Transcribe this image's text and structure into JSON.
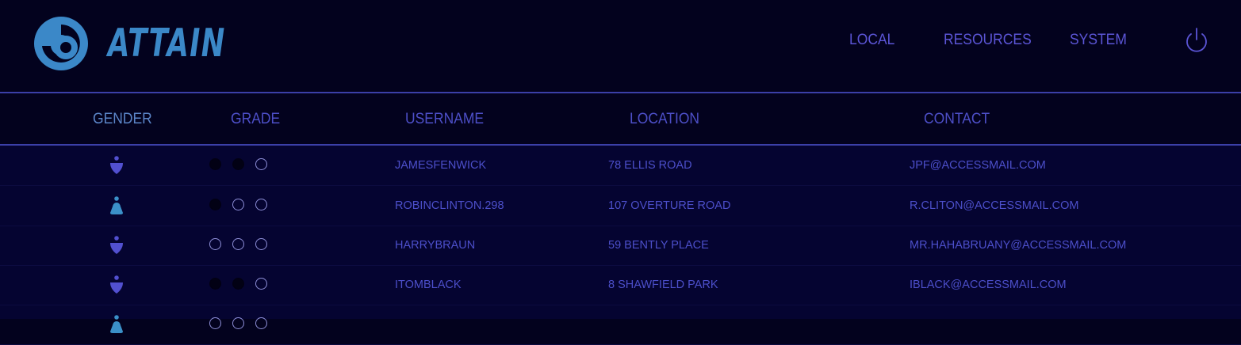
{
  "brand": {
    "name": "ATTAIN",
    "color": "#3b88c8"
  },
  "nav": {
    "items": [
      {
        "label": "LOCAL"
      },
      {
        "label": "RESOURCES"
      },
      {
        "label": "SYSTEM"
      }
    ],
    "power_icon": "power-icon"
  },
  "columns": {
    "gender": "GENDER",
    "grade": "GRADE",
    "username": "USERNAME",
    "location": "LOCATION",
    "contact": "CONTACT"
  },
  "rows": [
    {
      "gender": "male",
      "grade": 2,
      "username": "JAMESFENWICK",
      "location": "78 ELLIS ROAD",
      "contact": "JPF@ACCESSMAIL.COM"
    },
    {
      "gender": "female",
      "grade": 1,
      "username": "ROBINCLINTON.298",
      "location": "107 OVERTURE ROAD",
      "contact": "R.CLITON@ACCESSMAIL.COM"
    },
    {
      "gender": "male",
      "grade": 0,
      "username": "HARRYBRAUN",
      "location": "59 BENTLY PLACE",
      "contact": "MR.HAHABRUANY@ACCESSMAIL.COM"
    },
    {
      "gender": "male",
      "grade": 2,
      "username": "ITOMBLACK",
      "location": "8 SHAWFIELD PARK",
      "contact": "IBLACK@ACCESSMAIL.COM"
    },
    {
      "gender": "female",
      "grade": 0,
      "username": "",
      "location": "",
      "contact": ""
    }
  ],
  "colors": {
    "background": "#03021e",
    "table_background": "#050431",
    "accent": "#4c4fca",
    "male_icon": "#5250d0",
    "female_icon": "#3b90c8"
  }
}
